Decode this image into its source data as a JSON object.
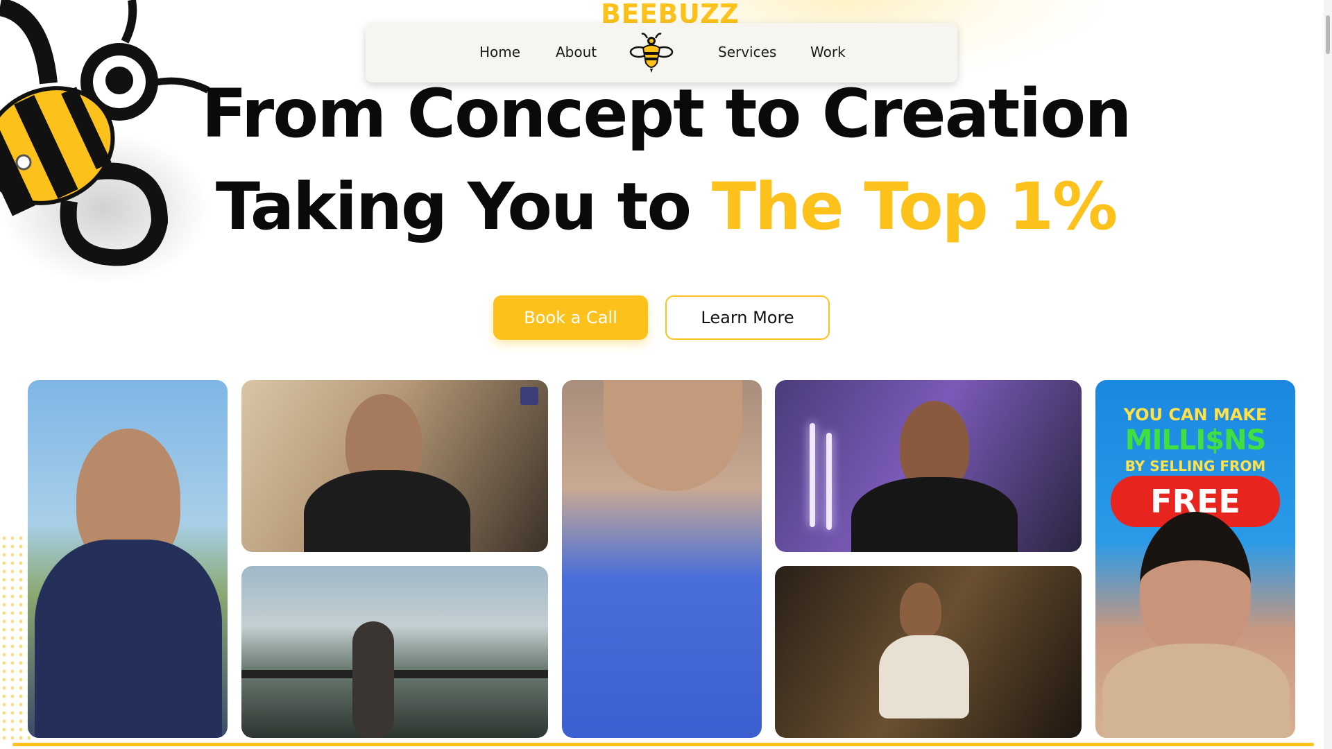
{
  "brand": {
    "name": "BEEBUZZ",
    "accent_color": "#fcc21b"
  },
  "nav": {
    "links": [
      {
        "label": "Home"
      },
      {
        "label": "About"
      },
      {
        "label": "Services"
      },
      {
        "label": "Work"
      }
    ],
    "logo_icon": "bee-icon"
  },
  "hero": {
    "line1": "From Concept to Creation",
    "line2_prefix": "Taking You to ",
    "line2_accent": "The Top 1%"
  },
  "cta": {
    "primary_label": "Book a Call",
    "secondary_label": "Learn More"
  },
  "gallery": {
    "thumb7": {
      "line1": "YOU CAN MAKE",
      "line2": "MILLI$NS",
      "line3": "BY SELLING FROM",
      "line4": "FREE"
    }
  }
}
